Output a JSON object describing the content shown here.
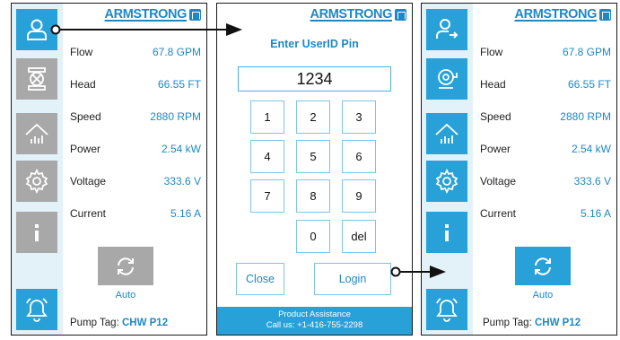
{
  "brand": "ARMSTRONG",
  "metrics": [
    {
      "label": "Flow",
      "value": "67.8 GPM"
    },
    {
      "label": "Head",
      "value": "66.55 FT"
    },
    {
      "label": "Speed",
      "value": "2880 RPM"
    },
    {
      "label": "Power",
      "value": "2.54 kW"
    },
    {
      "label": "Voltage",
      "value": "333.6 V"
    },
    {
      "label": "Current",
      "value": "5.16 A"
    }
  ],
  "auto_label": "Auto",
  "pump_tag": {
    "label": "Pump Tag:",
    "value": "CHW P12"
  },
  "login": {
    "title": "Enter UserID Pin",
    "pin_value": "1234",
    "keys": [
      "1",
      "2",
      "3",
      "4",
      "5",
      "6",
      "7",
      "8",
      "9",
      "0",
      "del"
    ],
    "close_label": "Close",
    "login_label": "Login",
    "footer_line1": "Product Assistance",
    "footer_line2": "Call us: +1-416-755-2298"
  },
  "sidebar_icons": [
    "user-icon",
    "pump-icon",
    "performance-chart-icon",
    "settings-gear-icon",
    "info-icon",
    "alarm-bell-icon"
  ],
  "colors": {
    "accent": "#1e88c6",
    "active_button": "#27a1d8",
    "inactive_button": "#a8a8a8",
    "sidebar_bg": "#e3f1f9"
  }
}
